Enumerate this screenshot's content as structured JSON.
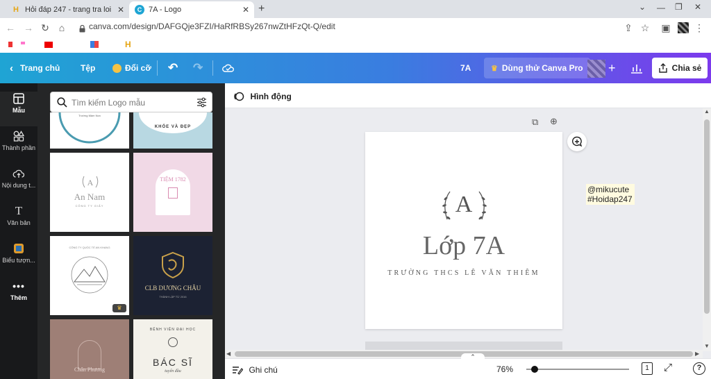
{
  "browser": {
    "tabs": [
      {
        "title": "Hỏi đáp 247 - trang tra loi",
        "favicon": "H",
        "active": false
      },
      {
        "title": "7A - Logo",
        "favicon": "C",
        "active": true
      }
    ],
    "new_tab": "+",
    "url": "canva.com/design/DAFGQje3FZI/HaRfRBSy267nwZtHFzQt-Q/edit"
  },
  "canva": {
    "back_label": "Trang chủ",
    "file_label": "Tệp",
    "resize_label": "Đổi cỡ",
    "design_title": "7A",
    "pro_label": "Dùng thử Canva Pro",
    "share_label": "Chia sẻ",
    "animate_label": "Hình động",
    "notes_label": "Ghi chú",
    "zoom": "76%",
    "zoom_fraction": 0.05,
    "page_num": "1"
  },
  "rail": [
    {
      "label": "Mẫu",
      "icon": "templates-icon"
    },
    {
      "label": "Thành phần",
      "icon": "elements-icon"
    },
    {
      "label": "Nội dung t...",
      "icon": "uploads-icon"
    },
    {
      "label": "Văn bản",
      "icon": "text-icon"
    },
    {
      "label": "Biểu tượn...",
      "icon": "brand-icon"
    },
    {
      "label": "Thêm",
      "icon": "more-icon"
    }
  ],
  "search": {
    "placeholder": "Tìm kiếm Logo mẫu"
  },
  "templates": {
    "t1": "Trường Mầm Non",
    "t2": "KHỎE VÀ ĐẸP",
    "t3_title": "An Nam",
    "t3_sub": "CÔNG TY GIẤY",
    "t4": "TIỆM 1782",
    "t5": "CÔNG TY QUỐC TẾ AN KHANG",
    "t6_title": "CLB DƯƠNG CHÂU",
    "t6_sub": "THÀNH LẬP TỪ 2016",
    "t7": "Chân Phương",
    "t8_top": "BỆNH VIỆN ĐẠI HỌC",
    "t8_title": "BÁC SĨ",
    "t8_sub": "tuyển đầu"
  },
  "logo": {
    "letter": "A",
    "title": "Lớp 7A",
    "subtitle": "TRƯỜNG THCS LÊ VĂN THIÊM"
  },
  "watermark": {
    "line1": "@mikucute",
    "line2": "#Hoidap247"
  }
}
